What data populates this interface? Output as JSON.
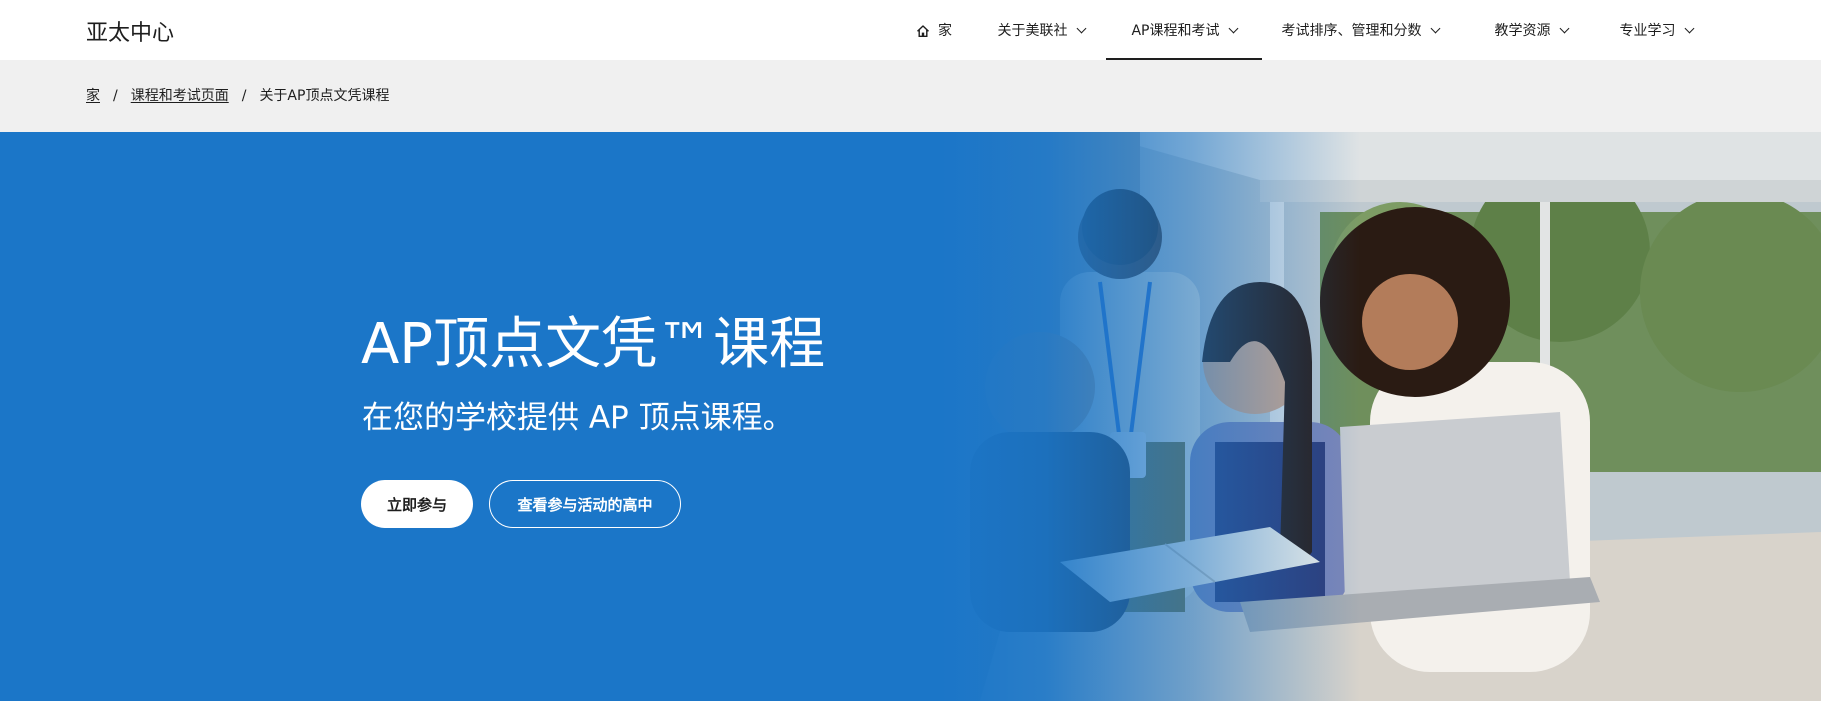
{
  "brand": "亚太中心",
  "nav": {
    "items": [
      {
        "label": "家",
        "icon": "home-icon",
        "active": false
      },
      {
        "label": "关于美联社",
        "icon": "chevron-down-icon",
        "active": false
      },
      {
        "label": "AP课程和考试",
        "icon": "chevron-down-icon",
        "active": true
      },
      {
        "label": "考试排序、管理和分数",
        "icon": "chevron-down-icon",
        "active": false
      },
      {
        "label": "教学资源",
        "icon": "chevron-down-icon",
        "active": false
      },
      {
        "label": "专业学习",
        "icon": "chevron-down-icon",
        "active": false
      }
    ]
  },
  "breadcrumb": {
    "items": [
      "家",
      "课程和考试页面",
      "关于AP顶点文凭课程"
    ],
    "separator": "/"
  },
  "hero": {
    "title": "AP顶点文凭™课程",
    "subtitle": "在您的学校提供 AP 顶点课程。",
    "primary_button": "立即参与",
    "secondary_button": "查看参与活动的高中"
  },
  "colors": {
    "hero_background": "#1b76c8",
    "breadcrumb_background": "#f0f0f0",
    "text": "#1e1e1e"
  }
}
